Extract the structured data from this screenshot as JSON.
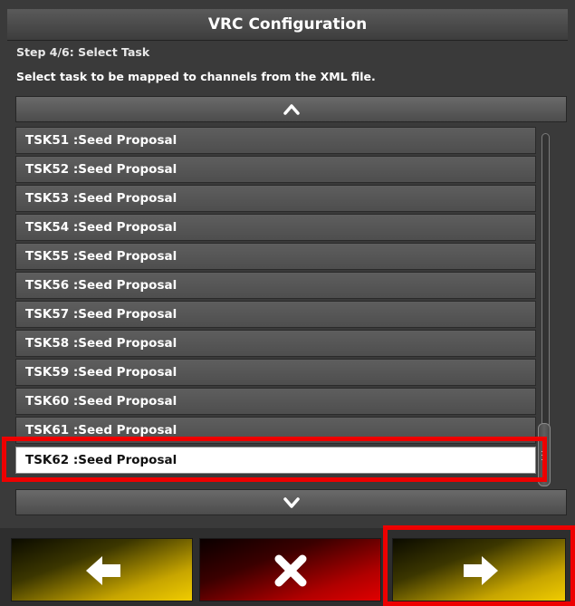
{
  "window": {
    "title": "VRC Configuration"
  },
  "wizard": {
    "step": "Step 4/6: Select Task",
    "instruction": "Select task to be mapped to channels from the XML file."
  },
  "tasks": [
    {
      "label": "TSK51 :Seed Proposal"
    },
    {
      "label": "TSK52 :Seed Proposal"
    },
    {
      "label": "TSK53 :Seed Proposal"
    },
    {
      "label": "TSK54 :Seed Proposal"
    },
    {
      "label": "TSK55 :Seed Proposal"
    },
    {
      "label": "TSK56 :Seed Proposal"
    },
    {
      "label": "TSK57 :Seed Proposal"
    },
    {
      "label": "TSK58 :Seed Proposal"
    },
    {
      "label": "TSK59 :Seed Proposal"
    },
    {
      "label": "TSK60 :Seed Proposal"
    },
    {
      "label": "TSK61 :Seed Proposal"
    },
    {
      "label": "TSK62 :Seed Proposal",
      "selected": true
    }
  ],
  "icons": {
    "scroll_up": "chevron-up-icon",
    "scroll_down": "chevron-down-icon",
    "back": "arrow-left-icon",
    "cancel": "close-icon",
    "next": "arrow-right-icon"
  },
  "colors": {
    "selection_highlight": "#ee0000",
    "nav_button_accent": "#f0cc00",
    "cancel_button_accent": "#e00000"
  }
}
